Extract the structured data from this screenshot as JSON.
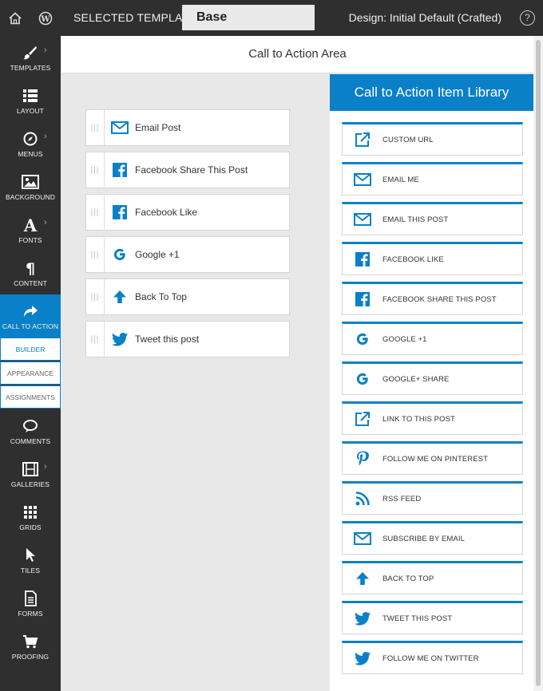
{
  "topbar": {
    "selected_template_label": "SELECTED TEMPLATE",
    "template_name": "Base",
    "design_label": "Design: Initial Default (Crafted)",
    "help_glyph": "?"
  },
  "sidebar": {
    "items": [
      {
        "label": "TEMPLATES",
        "icon": "brush-icon"
      },
      {
        "label": "LAYOUT",
        "icon": "list-icon"
      },
      {
        "label": "MENUS",
        "icon": "compass-icon"
      },
      {
        "label": "BACKGROUND",
        "icon": "image-icon"
      },
      {
        "label": "FONTS",
        "icon": "font-icon"
      },
      {
        "label": "CONTENT",
        "icon": "pilcrow-icon"
      },
      {
        "label": "CALL TO ACTION",
        "icon": "share-arrow-icon"
      },
      {
        "label": "COMMENTS",
        "icon": "chat-icon"
      },
      {
        "label": "GALLERIES",
        "icon": "film-icon"
      },
      {
        "label": "GRIDS",
        "icon": "grid-icon"
      },
      {
        "label": "TILES",
        "icon": "cursor-icon"
      },
      {
        "label": "FORMS",
        "icon": "document-icon"
      },
      {
        "label": "PROOFING",
        "icon": "cart-icon"
      }
    ],
    "subnav": [
      "BUILDER",
      "APPEARANCE",
      "ASSIGNMENTS"
    ]
  },
  "main": {
    "title": "Call to Action Area",
    "builder_items": [
      {
        "label": "Email Post",
        "icon": "email-icon"
      },
      {
        "label": "Facebook Share This Post",
        "icon": "facebook-icon"
      },
      {
        "label": "Facebook Like",
        "icon": "facebook-icon"
      },
      {
        "label": "Google +1",
        "icon": "google-icon"
      },
      {
        "label": "Back To Top",
        "icon": "arrow-up-icon"
      },
      {
        "label": "Tweet this post",
        "icon": "twitter-icon"
      }
    ]
  },
  "library": {
    "title": "Call to Action Item Library",
    "items": [
      {
        "label": "CUSTOM URL",
        "icon": "external-link-icon"
      },
      {
        "label": "EMAIL ME",
        "icon": "email-icon"
      },
      {
        "label": "EMAIL THIS POST",
        "icon": "email-icon"
      },
      {
        "label": "FACEBOOK LIKE",
        "icon": "facebook-icon"
      },
      {
        "label": "FACEBOOK SHARE THIS POST",
        "icon": "facebook-icon"
      },
      {
        "label": "GOOGLE +1",
        "icon": "google-icon"
      },
      {
        "label": "GOOGLE+ SHARE",
        "icon": "google-icon"
      },
      {
        "label": "LINK TO THIS POST",
        "icon": "external-link-icon"
      },
      {
        "label": "FOLLOW ME ON PINTEREST",
        "icon": "pinterest-icon"
      },
      {
        "label": "RSS FEED",
        "icon": "rss-icon"
      },
      {
        "label": "SUBSCRIBE BY EMAIL",
        "icon": "email-icon"
      },
      {
        "label": "BACK TO TOP",
        "icon": "arrow-up-icon"
      },
      {
        "label": "TWEET THIS POST",
        "icon": "twitter-icon"
      },
      {
        "label": "FOLLOW ME ON TWITTER",
        "icon": "twitter-icon"
      }
    ]
  },
  "colors": {
    "accent": "#0a80c8",
    "dark": "#2f2f2f"
  }
}
